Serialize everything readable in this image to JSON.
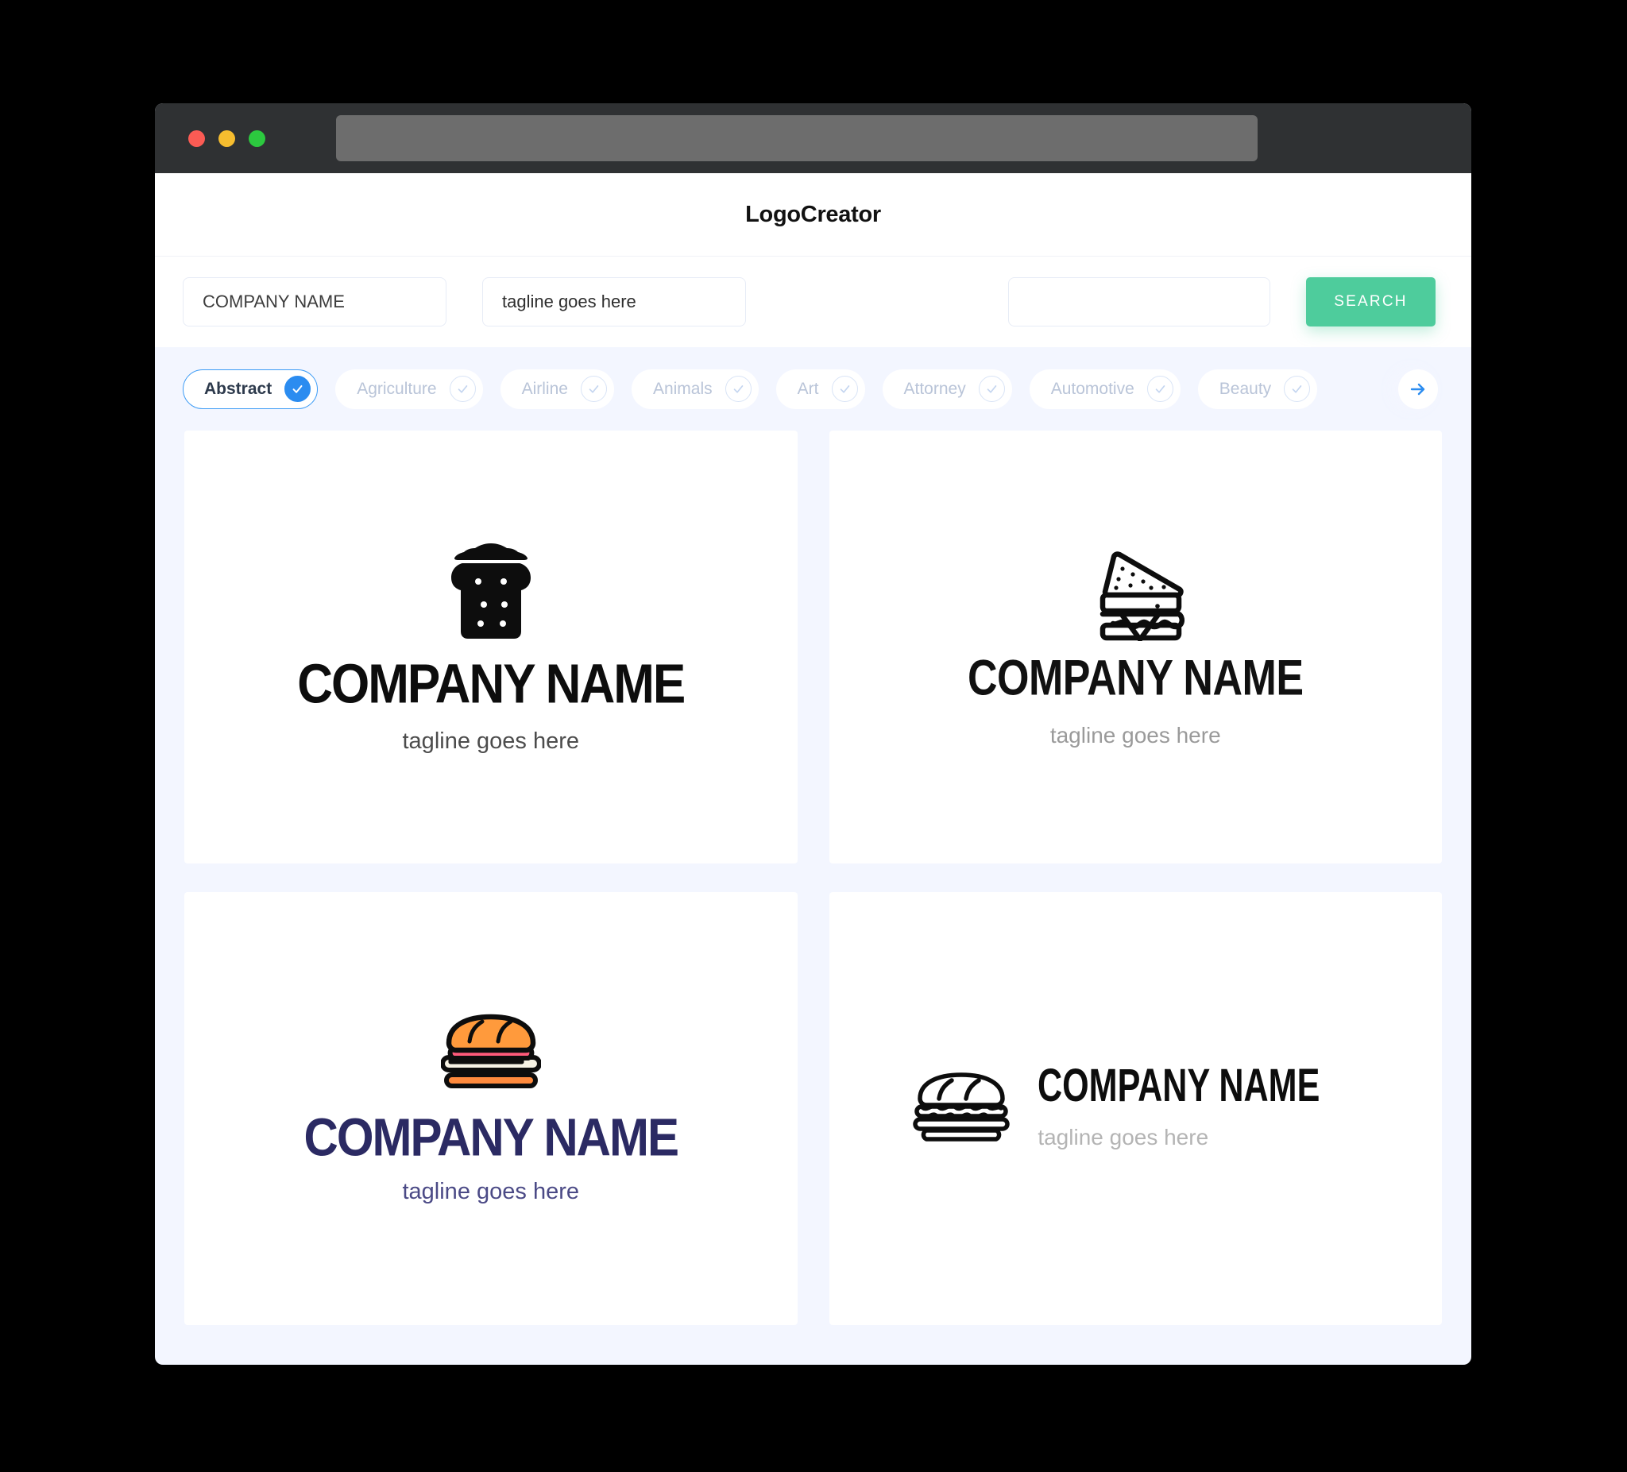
{
  "window": {
    "titlebar": {
      "close_label": "close",
      "minimize_label": "minimize",
      "maximize_label": "maximize",
      "url_value": ""
    }
  },
  "header": {
    "brand_title": "LogoCreator"
  },
  "search": {
    "company_name_value": "COMPANY NAME",
    "company_name_placeholder": "COMPANY NAME",
    "tagline_value": "tagline goes here",
    "tagline_placeholder": "tagline goes here",
    "keyword_value": "",
    "keyword_placeholder": "",
    "search_button_label": "SEARCH"
  },
  "categories": {
    "next_arrow_icon": "arrow-right-icon",
    "items": [
      {
        "label": "Abstract",
        "selected": true
      },
      {
        "label": "Agriculture",
        "selected": false
      },
      {
        "label": "Airline",
        "selected": false
      },
      {
        "label": "Animals",
        "selected": false
      },
      {
        "label": "Art",
        "selected": false
      },
      {
        "label": "Attorney",
        "selected": false
      },
      {
        "label": "Automotive",
        "selected": false
      },
      {
        "label": "Beauty",
        "selected": false
      }
    ]
  },
  "results": {
    "cards": [
      {
        "icon": "bread-loaf-icon",
        "layout": "stacked",
        "company_name": "COMPANY NAME",
        "tagline": "tagline goes here",
        "name_color": "#0d0d0d",
        "tagline_color": "#4c4c4c"
      },
      {
        "icon": "triangle-sandwich-icon",
        "layout": "stacked",
        "company_name": "COMPANY NAME",
        "tagline": "tagline goes here",
        "name_color": "#111111",
        "tagline_color": "#9a9a9a"
      },
      {
        "icon": "sub-sandwich-color-icon",
        "layout": "stacked",
        "company_name": "COMPANY NAME",
        "tagline": "tagline goes here",
        "name_color": "#2b2a63",
        "tagline_color": "#4b4a86"
      },
      {
        "icon": "sub-sandwich-outline-icon",
        "layout": "horizontal",
        "company_name": "COMPANY NAME",
        "tagline": "tagline goes here",
        "name_color": "#0d0d0d",
        "tagline_color": "#b4b4b4"
      }
    ]
  },
  "colors": {
    "accent_green": "#4ecc9c",
    "accent_blue": "#2b8cf0",
    "page_background": "#f3f6ff",
    "titlebar": "#2f3133"
  }
}
